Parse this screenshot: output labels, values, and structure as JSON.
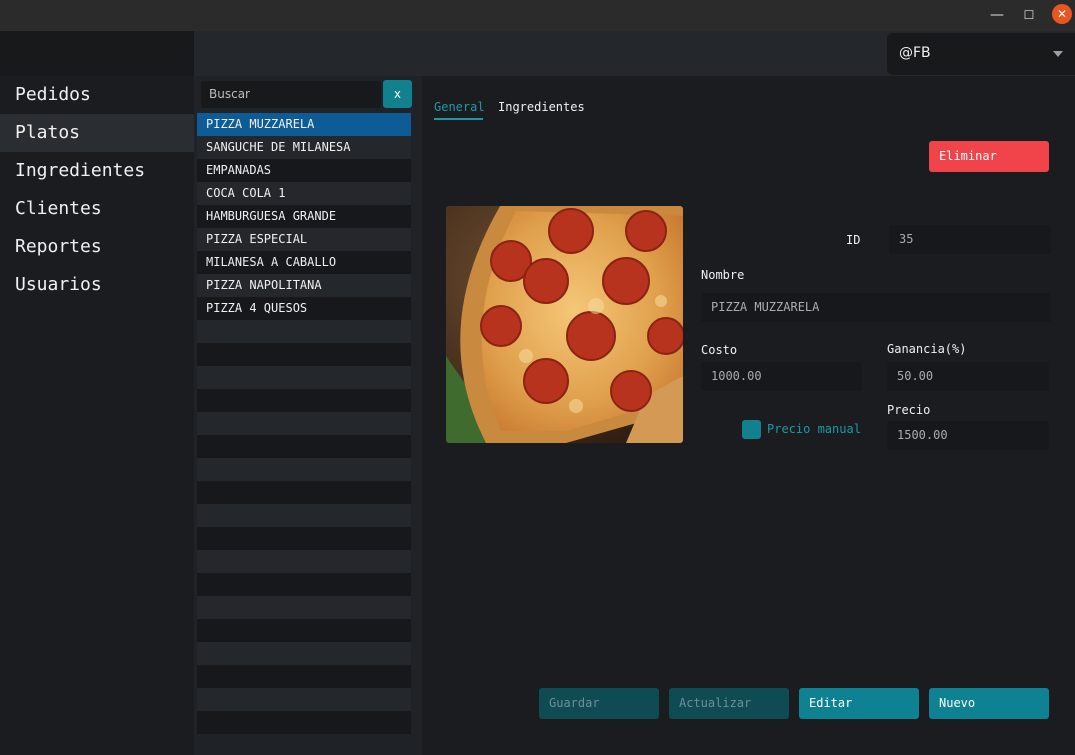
{
  "window": {
    "minimize": "—",
    "maximize": "☐",
    "close": "✕"
  },
  "sidebar": {
    "items": [
      {
        "label": "Pedidos"
      },
      {
        "label": "Platos"
      },
      {
        "label": "Ingredientes"
      },
      {
        "label": "Clientes"
      },
      {
        "label": "Reportes"
      },
      {
        "label": "Usuarios"
      }
    ],
    "active": "Platos"
  },
  "user": {
    "selected": "@FB"
  },
  "search": {
    "placeholder": "Buscar",
    "clear_label": "x"
  },
  "dishes": [
    "PIZZA MUZZARELA",
    "SANGUCHE DE MILANESA",
    "EMPANADAS",
    "COCA COLA 1",
    "HAMBURGUESA GRANDE",
    "PIZZA ESPECIAL",
    "MILANESA A CABALLO",
    "PIZZA NAPOLITANA",
    "PIZZA 4 QUESOS"
  ],
  "tabs": {
    "general": "General",
    "ingredientes": "Ingredientes"
  },
  "actions": {
    "delete": "Eliminar",
    "save": "Guardar",
    "update": "Actualizar",
    "edit": "Editar",
    "new": "Nuevo"
  },
  "form": {
    "id_label": "ID",
    "id_value": "35",
    "name_label": "Nombre",
    "name_value": "PIZZA MUZZARELA",
    "cost_label": "Costo",
    "cost_value": "1000.00",
    "margin_label": "Ganancia(%)",
    "margin_value": "50.00",
    "price_label": "Precio",
    "price_value": "1500.00",
    "manual_price_label": "Precio manual"
  },
  "colors": {
    "accent": "#0e8292",
    "danger": "#f0444a",
    "selected_row": "#0e5c95"
  }
}
